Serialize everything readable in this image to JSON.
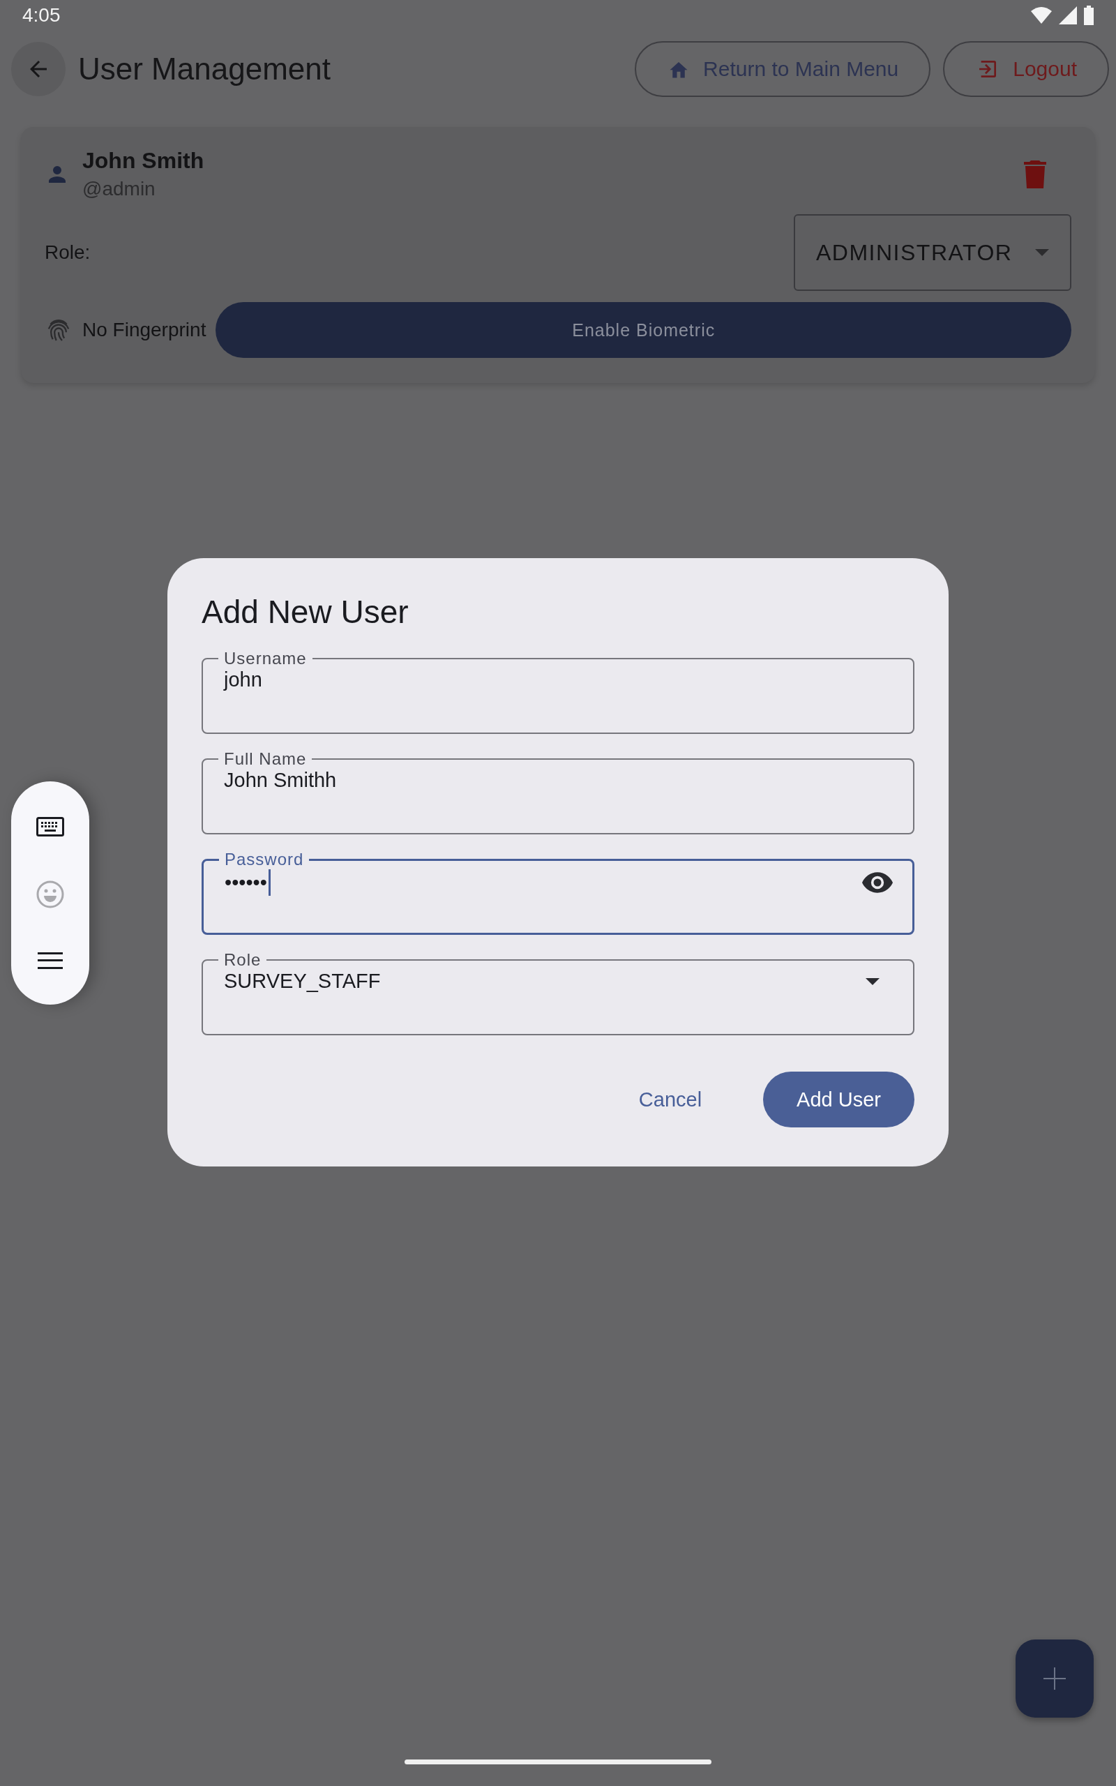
{
  "status_bar": {
    "time": "4:05"
  },
  "app_bar": {
    "title": "User Management",
    "actions": [
      {
        "label": "Return to Main Menu",
        "kind": "home"
      },
      {
        "label": "Logout",
        "kind": "logout"
      }
    ]
  },
  "users": [
    {
      "name": "John Smith",
      "username": "@admin",
      "role_label": "Role:",
      "role": "ADMINISTRATOR",
      "biometric_status": "No Fingerprint",
      "biometric_action": "Enable Biometric"
    }
  ],
  "dialog": {
    "title": "Add New User",
    "fields": [
      {
        "label": "Username",
        "value": "john",
        "kind": "text",
        "focused": false
      },
      {
        "label": "Full Name",
        "value": "John Smithh",
        "kind": "text",
        "focused": false
      },
      {
        "label": "Password",
        "value": "••••••",
        "kind": "password",
        "focused": true
      },
      {
        "label": "Role",
        "value": "SURVEY_STAFF",
        "kind": "select",
        "focused": false
      }
    ],
    "buttons": [
      {
        "label": "Cancel",
        "kind": "text"
      },
      {
        "label": "Add User",
        "kind": "filled"
      }
    ]
  }
}
